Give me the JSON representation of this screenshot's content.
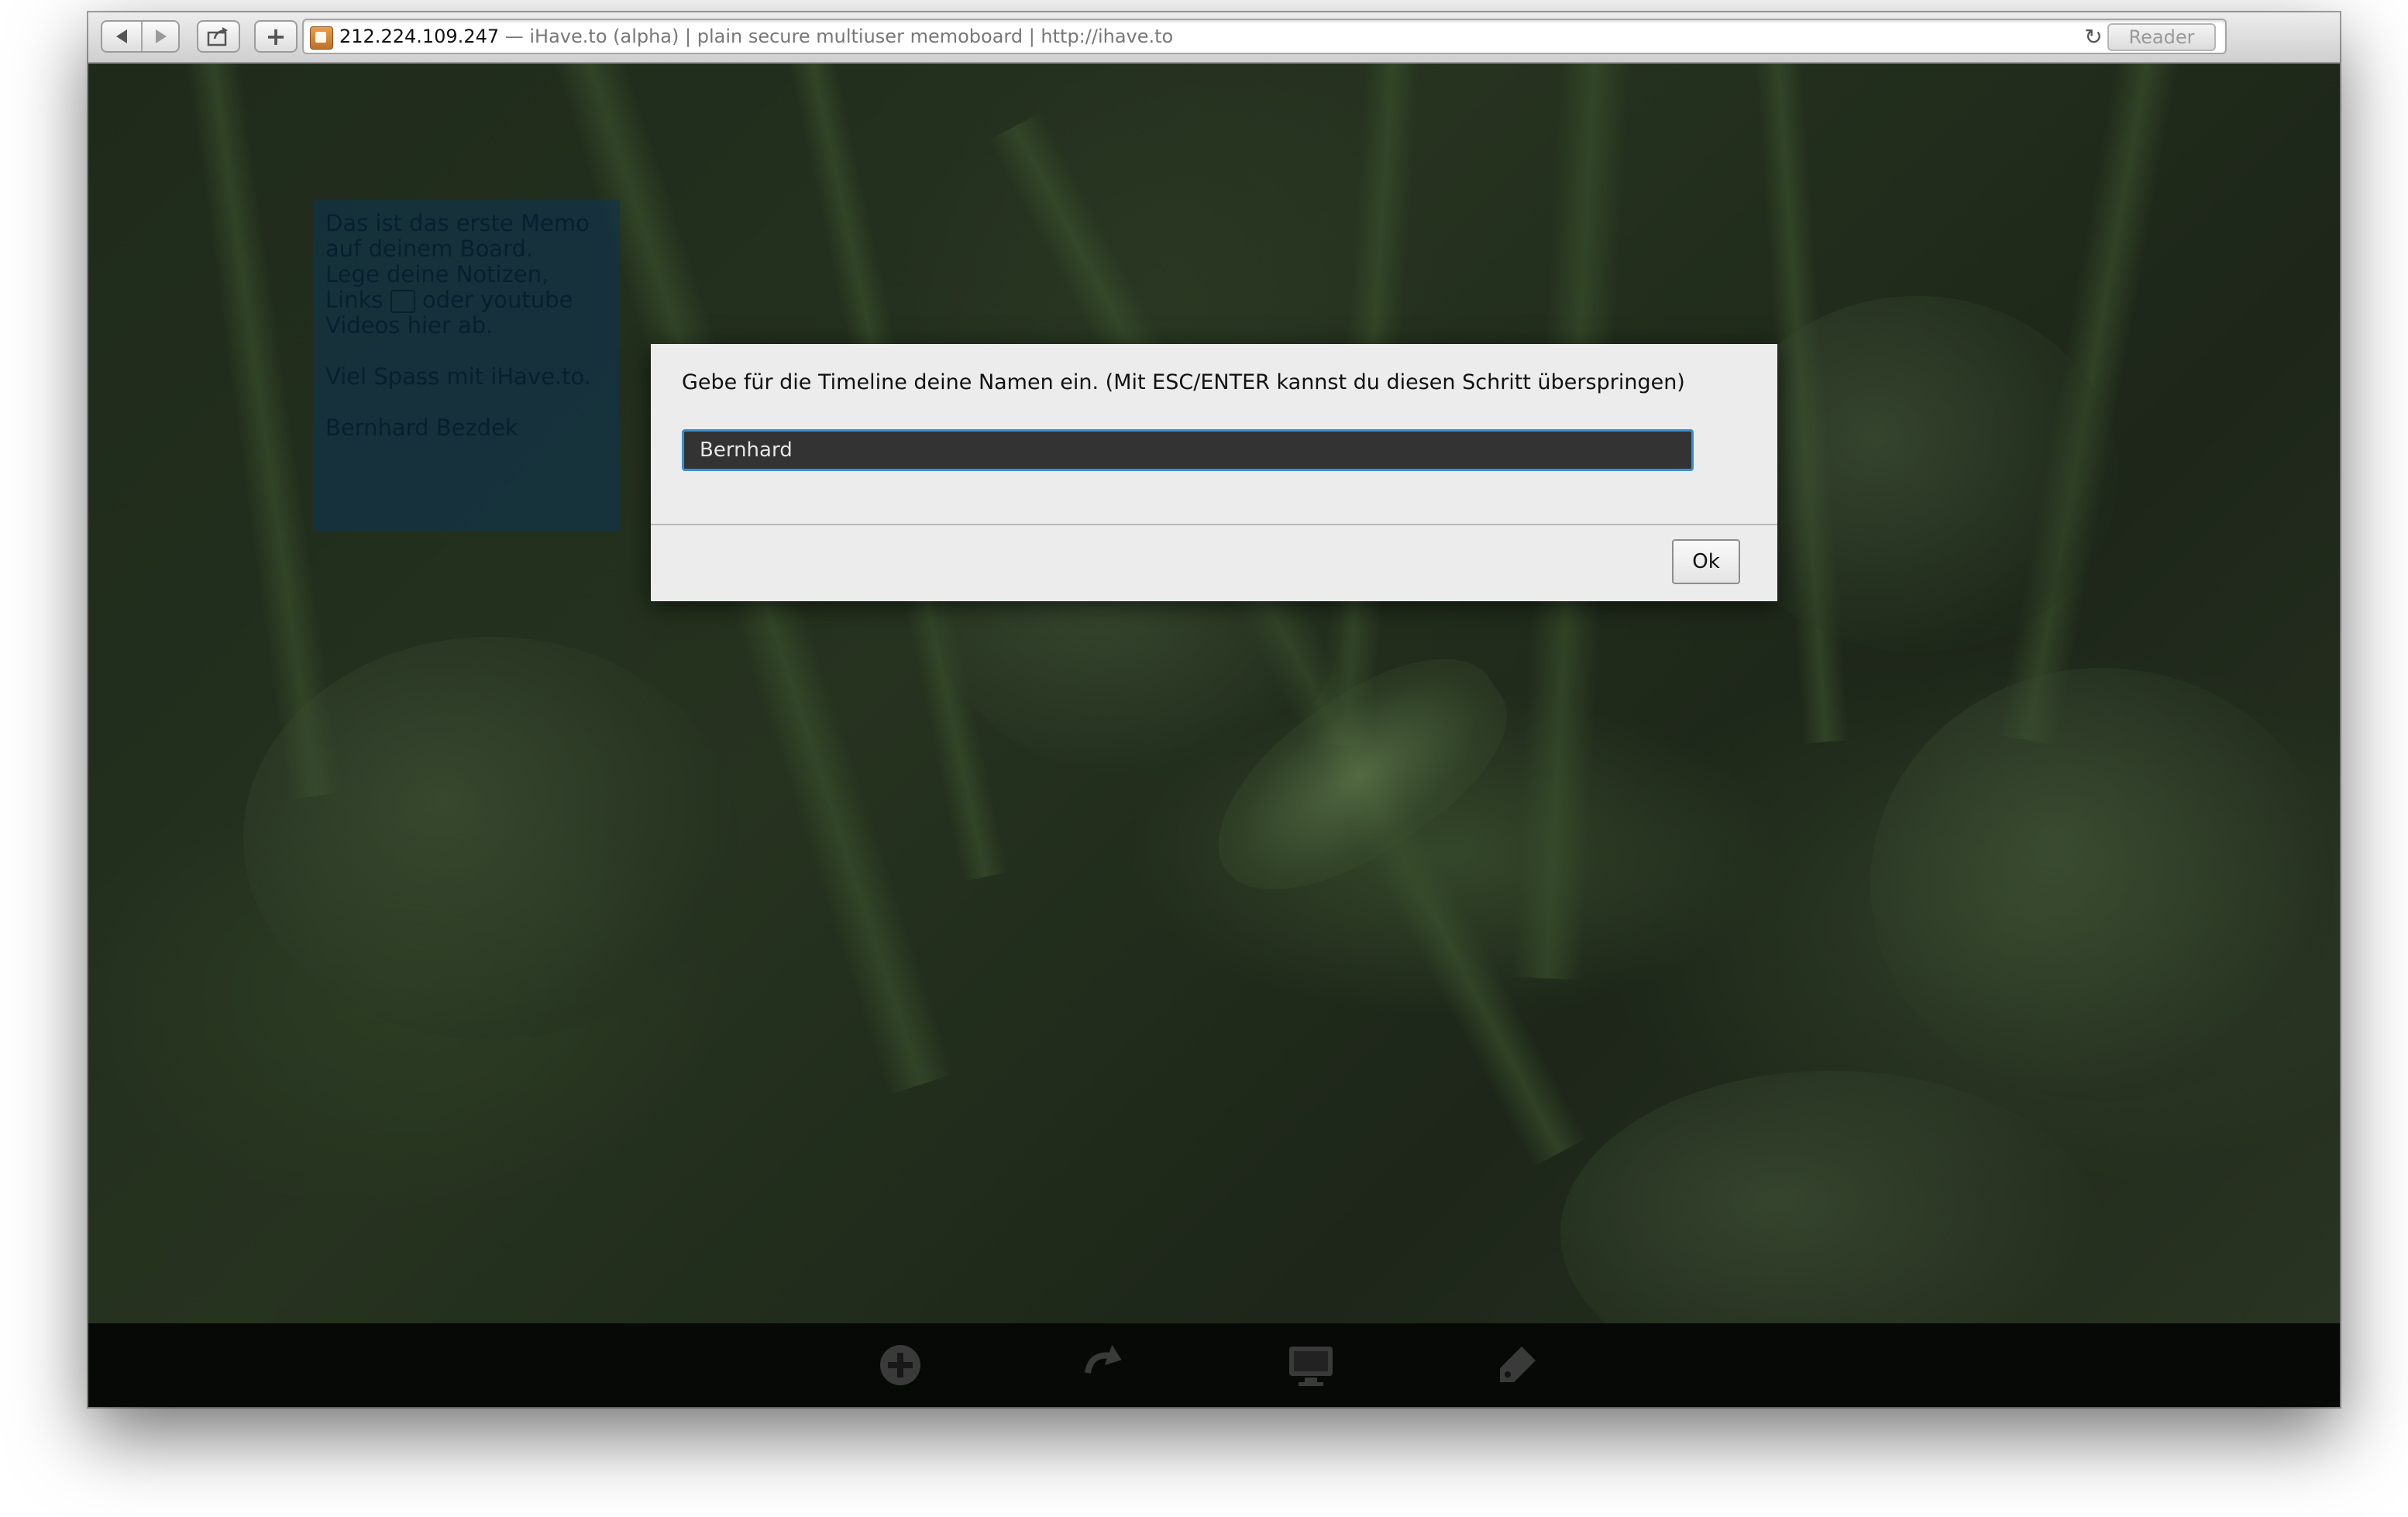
{
  "browser": {
    "address_host": "212.224.109.247",
    "address_title": " — iHave.to (alpha) | plain secure multiuser memoboard | http://ihave.to",
    "reader_label": "Reader",
    "reload_glyph": "↻",
    "add_glyph": "+"
  },
  "memo": {
    "lines": [
      "Das ist das erste Memo",
      "auf deinem Board.",
      "Lege deine Notizen,",
      "Links",
      "oder youtube",
      "Videos hier ab.",
      "Viel Spass mit iHave.to.",
      "Bernhard Bezdek"
    ]
  },
  "dialog": {
    "prompt": "Gebe für die Timeline deine Namen ein. (Mit ESC/ENTER kannst du diesen Schritt überspringen)",
    "name_value": "Bernhard",
    "ok_label": "Ok"
  },
  "bottom_bar": {
    "icons": [
      "add-memo-icon",
      "redo-icon",
      "screen-icon",
      "tag-icon"
    ]
  },
  "colors": {
    "memo_background": "#0e344e",
    "input_border": "#3a8fd0",
    "input_background": "#333333",
    "dialog_background": "#ececec"
  }
}
